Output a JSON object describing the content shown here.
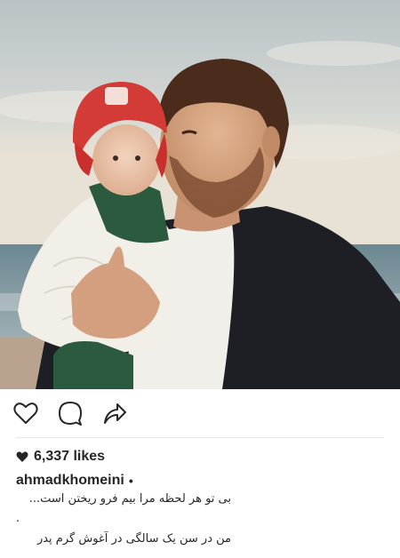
{
  "post": {
    "likes_text": "6,337 likes",
    "username": "ahmadkhomeini",
    "verified_dot": "•",
    "caption_line_1": "بی تو هر لحظه مرا بیم فرو ریختن است...",
    "caption_line_2": ".",
    "caption_line_3": "من در سن یک سالگی در آغوش گرم پدر"
  },
  "icons": {
    "like": "heart-outline-icon",
    "comment": "speech-bubble-icon",
    "share": "share-arrow-icon",
    "likes_heart": "heart-filled-icon"
  },
  "colors": {
    "text": "#262626",
    "divider": "#e6e6e6",
    "background": "#ffffff"
  }
}
